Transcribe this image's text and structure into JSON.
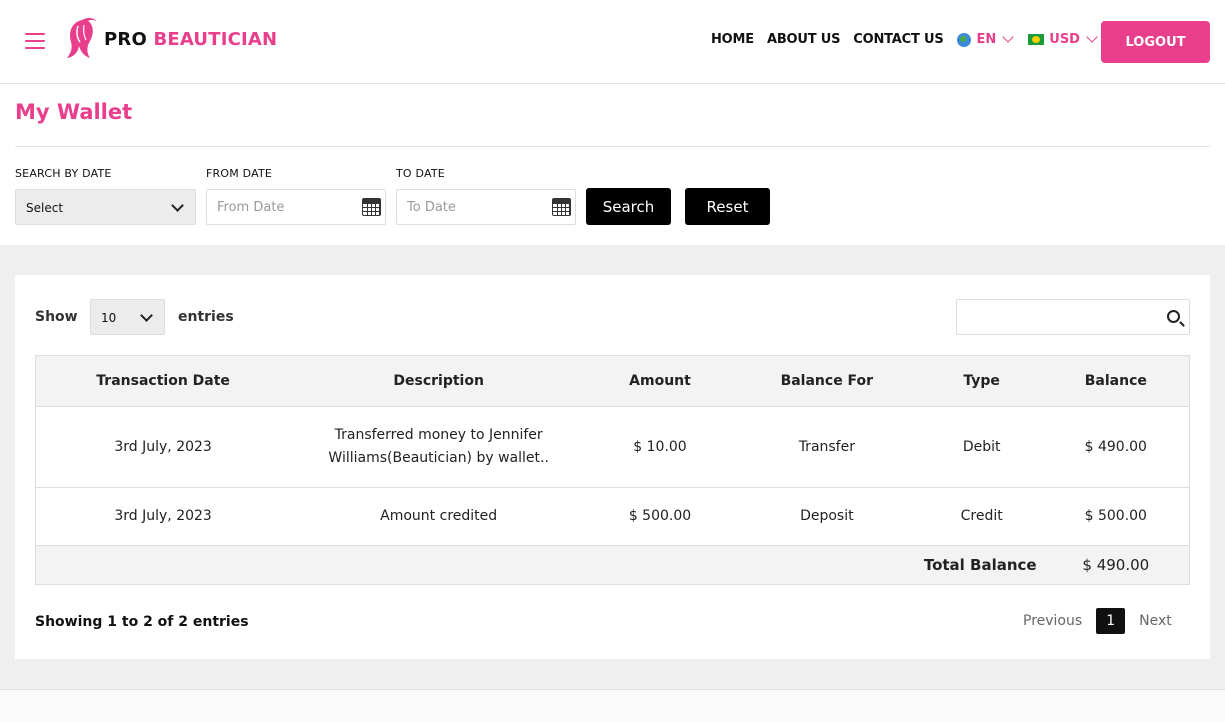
{
  "brand": {
    "pro": "PRO",
    "beautician": "BEAUTICIAN",
    "accent": "#e83e8c"
  },
  "nav": {
    "home": "HOME",
    "about": "ABOUT US",
    "contact": "CONTACT US",
    "language": "EN",
    "currency": "USD",
    "logout": "LOGOUT"
  },
  "page": {
    "title": "My Wallet"
  },
  "filters": {
    "search_by_date_label": "SEARCH BY DATE",
    "search_by_date_value": "Select",
    "from_label": "FROM DATE",
    "from_placeholder": "From Date",
    "to_label": "TO DATE",
    "to_placeholder": "To Date",
    "search_button": "Search",
    "reset_button": "Reset"
  },
  "table_controls": {
    "show_label": "Show",
    "page_size": "10",
    "entries_label": "entries"
  },
  "table": {
    "headers": [
      "Transaction Date",
      "Description",
      "Amount",
      "Balance For",
      "Type",
      "Balance"
    ],
    "rows": [
      [
        "3rd July, 2023",
        "Transferred money to Jennifer Williams(Beautician) by wallet..",
        "$ 10.00",
        "Transfer",
        "Debit",
        "$ 490.00"
      ],
      [
        "3rd July, 2023",
        "Amount credited",
        "$ 500.00",
        "Deposit",
        "Credit",
        "$ 500.00"
      ]
    ],
    "total_label": "Total Balance",
    "total_value": "$ 490.00"
  },
  "footer": {
    "showing": "Showing 1 to 2 of 2 entries",
    "previous": "Previous",
    "page": "1",
    "next": "Next"
  }
}
